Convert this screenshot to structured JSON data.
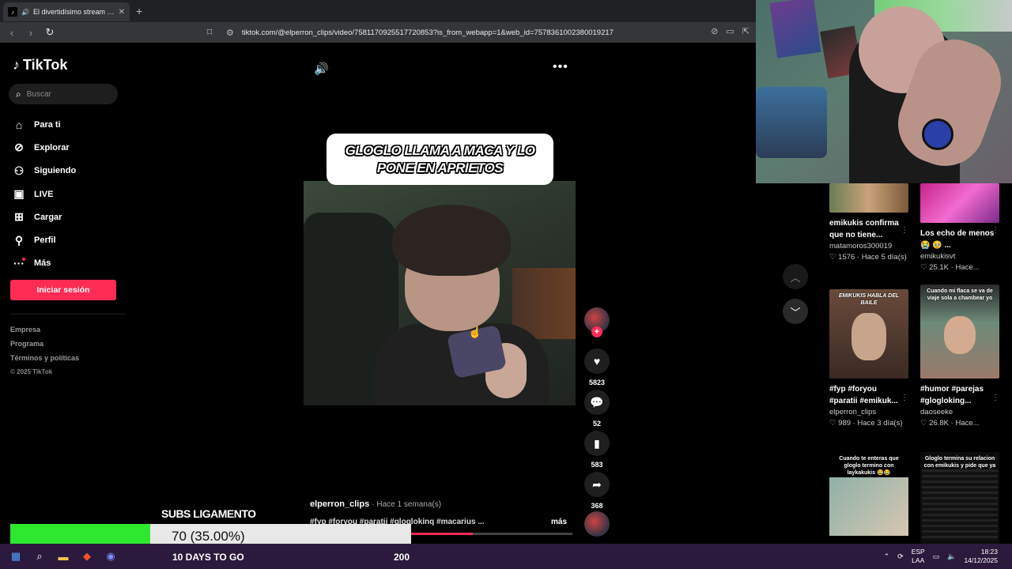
{
  "browser": {
    "tab_title": "El divertidísimo stream de Ma",
    "url": "tiktok.com/@elperron_clips/video/7581170925517720853?is_from_webapp=1&web_id=7578361002380019217"
  },
  "sidebar": {
    "brand": "TikTok",
    "search_placeholder": "Buscar",
    "items": [
      {
        "label": "Para ti",
        "icon": "home-icon"
      },
      {
        "label": "Explorar",
        "icon": "compass-icon"
      },
      {
        "label": "Siguiendo",
        "icon": "following-icon"
      },
      {
        "label": "LIVE",
        "icon": "live-icon"
      },
      {
        "label": "Cargar",
        "icon": "upload-icon"
      },
      {
        "label": "Perfil",
        "icon": "profile-icon"
      },
      {
        "label": "Más",
        "icon": "more-icon"
      }
    ],
    "login_label": "Iniciar sesión",
    "footer": [
      "Empresa",
      "Programa",
      "Términos y políticas"
    ],
    "copyright": "© 2025 TikTok"
  },
  "video": {
    "caption": "GLOGLO LLAMA A MACA Y LO PONE EN APRIETOS",
    "author": "elperron_clips",
    "time": "· Hace 1 semana(s)",
    "tags": "#fyp #foryou #paratii #gloglokinq #macarius ...",
    "more_label": "más",
    "progress": 0.38,
    "likes": "5823",
    "comments": "52",
    "saves": "583",
    "shares": "368"
  },
  "recommendations": [
    {
      "title": "emikukis confirma que no tiene...",
      "author": "matamoros300019",
      "likes": "1576",
      "time": "Hace 5 día(s)",
      "thumb_text": ""
    },
    {
      "title": "Los echo de menos 😭 🥹 ...",
      "author": "emikukisvt",
      "likes": "25.1K",
      "time": "Hace...",
      "thumb_text": ""
    },
    {
      "title": "#fyp #foryou #paratii #emikuk...",
      "author": "elperron_clips",
      "likes": "989",
      "time": "Hace 3 día(s)",
      "thumb_text": "EMIKUKIS HABLA DEL BAILE"
    },
    {
      "title": "#humor #parejas #glogloking...",
      "author": "daoseeke",
      "likes": "26.8K",
      "time": "Hace...",
      "thumb_text": "Cuando mi flaca se va de viaje sola a chambear yo"
    },
    {
      "title": "",
      "author": "",
      "likes": "",
      "time": "",
      "thumb_text": "Cuando te enteras que gloglo termino con laykakukis 😂😂"
    },
    {
      "title": "",
      "author": "",
      "likes": "",
      "time": "",
      "thumb_text": "Gloglo termina su relacion con emikukis y pide que ya no lo relacionen con ella"
    }
  ],
  "overlay": {
    "title": "SUBS LIGAMENTO",
    "goal_text": "70 (35.00%)",
    "goal_fraction": 0.35,
    "days": "10 DAYS TO GO",
    "goal_target": "200"
  },
  "taskbar": {
    "lang1": "ESP",
    "lang2": "LAA",
    "time": "18:23",
    "date": "14/12/2025"
  }
}
